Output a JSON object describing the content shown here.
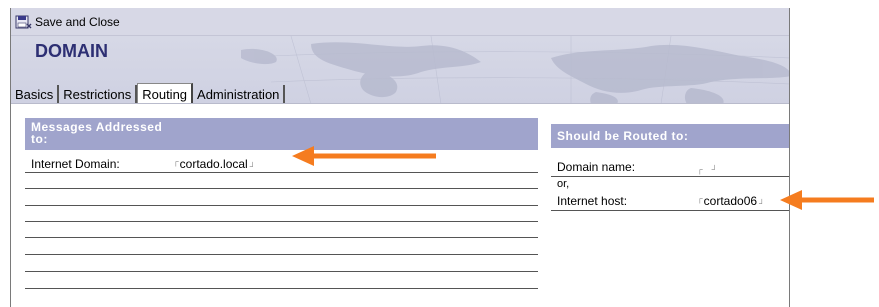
{
  "toolbar": {
    "save_close_label": "Save and Close"
  },
  "document": {
    "title": "DOMAIN"
  },
  "tabs": [
    {
      "label": "Basics"
    },
    {
      "label": "Restrictions"
    },
    {
      "label": "Routing"
    },
    {
      "label": "Administration"
    }
  ],
  "left_panel": {
    "heading": "Messages Addressed to:",
    "heading_line1": "Messages Addressed",
    "heading_line2": "to:",
    "internet_domain_label": "Internet Domain:",
    "internet_domain_value": "cortado.local"
  },
  "right_panel": {
    "heading": "Should be Routed to:",
    "domain_name_label": "Domain name:",
    "domain_name_value": "",
    "or_label": "or,",
    "internet_host_label": "Internet host:",
    "internet_host_value": "cortado06"
  },
  "colors": {
    "section_header_bg": "#a0a4cc",
    "title_color": "#2d2f73",
    "annotation_arrow": "#f57c1f"
  }
}
